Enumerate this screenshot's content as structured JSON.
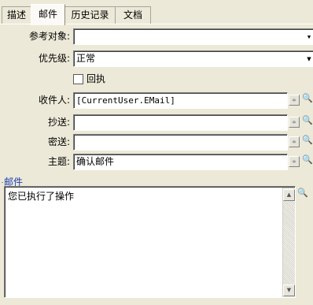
{
  "tabs": [
    {
      "label": "描述"
    },
    {
      "label": "邮件"
    },
    {
      "label": "历史记录"
    },
    {
      "label": "文档"
    }
  ],
  "form": {
    "reference": {
      "label": "参考对象:",
      "value": ""
    },
    "priority": {
      "label": "优先级:",
      "value": "正常"
    },
    "receipt": {
      "label": "回执",
      "checked": false
    },
    "to": {
      "label": "收件人:",
      "value": "[CurrentUser.EMail]"
    },
    "cc": {
      "label": "抄送:",
      "value": ""
    },
    "bcc": {
      "label": "密送:",
      "value": ""
    },
    "subject": {
      "label": "主题:",
      "value": "确认邮件"
    }
  },
  "mail": {
    "group_title": "邮件",
    "body": "您已执行了操作"
  },
  "icons": {
    "dropdown": "triangle-down-icon",
    "zoom": "magnifier-icon",
    "spinner": "spin-arrows-icon"
  },
  "colors": {
    "background": "#ece9d8",
    "group_title": "#1b3fb0"
  }
}
